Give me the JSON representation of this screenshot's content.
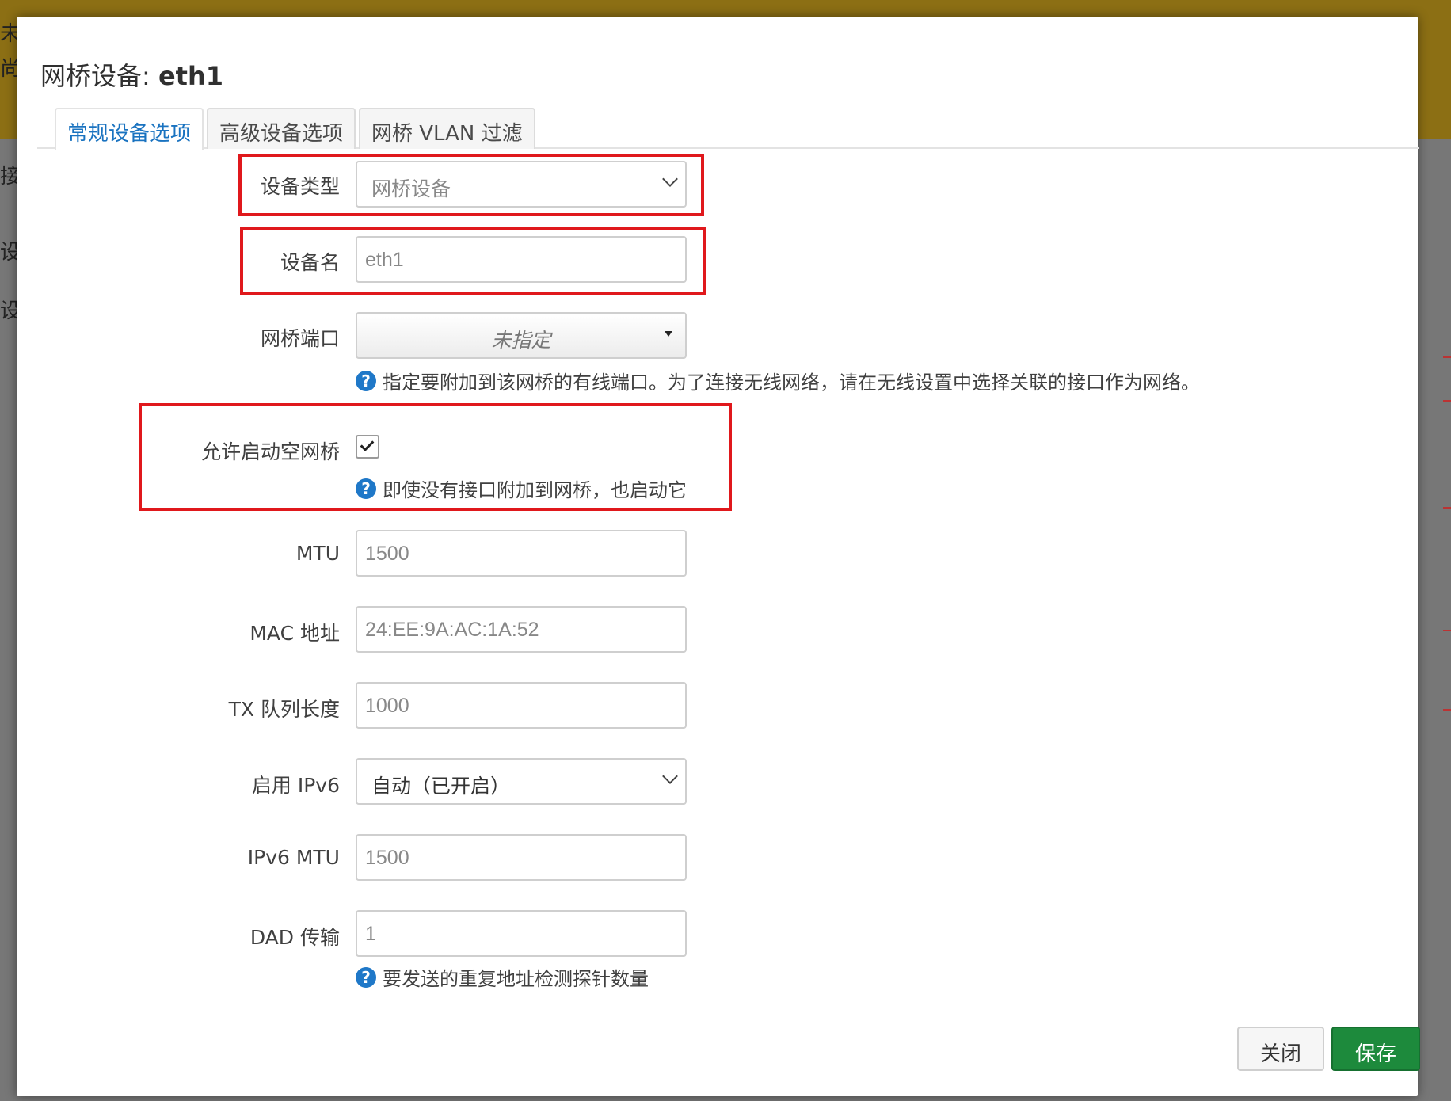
{
  "background": {
    "chars": [
      "未",
      "尚",
      "接",
      "设",
      "设"
    ]
  },
  "modal": {
    "title_prefix": "网桥设备: ",
    "title_device": "eth1",
    "tabs": [
      {
        "label": "常规设备选项",
        "active": true
      },
      {
        "label": "高级设备选项",
        "active": false
      },
      {
        "label": "网桥 VLAN 过滤",
        "active": false
      }
    ],
    "fields": {
      "device_type": {
        "label": "设备类型",
        "value": "网桥设备"
      },
      "device_name": {
        "label": "设备名",
        "value": "eth1"
      },
      "bridge_ports": {
        "label": "网桥端口",
        "value": "未指定",
        "help": "指定要附加到该网桥的有线端口。为了连接无线网络，请在无线设置中选择关联的接口作为网络。"
      },
      "bring_up_empty": {
        "label": "允许启动空网桥",
        "checked": true,
        "help": "即使没有接口附加到网桥，也启动它"
      },
      "mtu": {
        "label": "MTU",
        "value": "1500"
      },
      "mac": {
        "label": "MAC 地址",
        "value": "24:EE:9A:AC:1A:52"
      },
      "txqueuelen": {
        "label": "TX 队列长度",
        "value": "1000"
      },
      "ipv6": {
        "label": "启用 IPv6",
        "value": "自动（已开启）"
      },
      "ipv6_mtu": {
        "label": "IPv6 MTU",
        "value": "1500"
      },
      "dad": {
        "label": "DAD 传输",
        "value": "1",
        "help": "要发送的重复地址检测探针数量"
      }
    },
    "help_glyph": "?",
    "buttons": {
      "close": "关闭",
      "save": "保存"
    }
  },
  "colors": {
    "accent": "#1a73c0",
    "save_button": "#1d8a3c",
    "highlight_box": "#e0181c",
    "banner": "#8c6f14"
  }
}
